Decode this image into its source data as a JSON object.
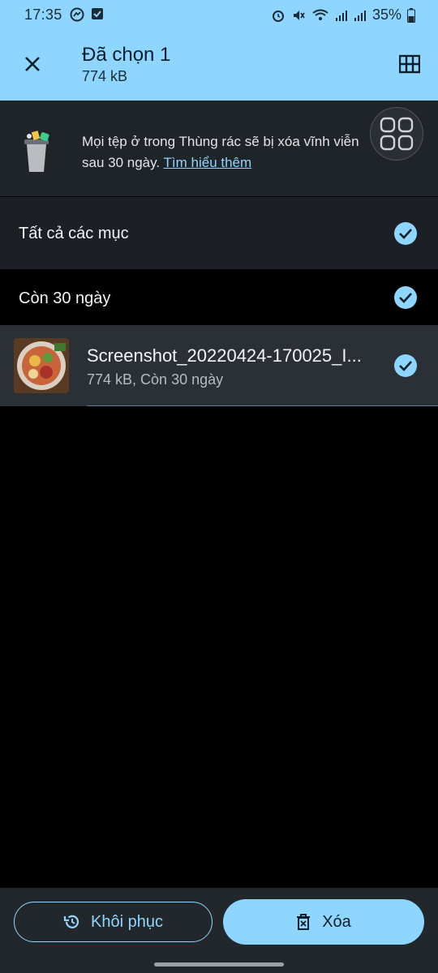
{
  "status": {
    "time": "17:35",
    "battery": "35%"
  },
  "appbar": {
    "title": "Đã chọn 1",
    "subtitle": "774 kB"
  },
  "banner": {
    "text": "Mọi tệp ở trong Thùng rác sẽ bị xóa vĩnh viễn",
    "text2": "sau 30 ngày.",
    "link": "Tìm hiểu thêm"
  },
  "list": {
    "all_label": "Tất cả các mục",
    "group_label": "Còn 30 ngày",
    "file": {
      "name": "Screenshot_20220424-170025_I...",
      "meta": "774 kB, Còn 30 ngày"
    }
  },
  "actions": {
    "restore": "Khôi phục",
    "delete": "Xóa"
  },
  "colors": {
    "accent": "#8ed6ff",
    "panel": "#1f2428",
    "selected_row": "#2a3036"
  }
}
